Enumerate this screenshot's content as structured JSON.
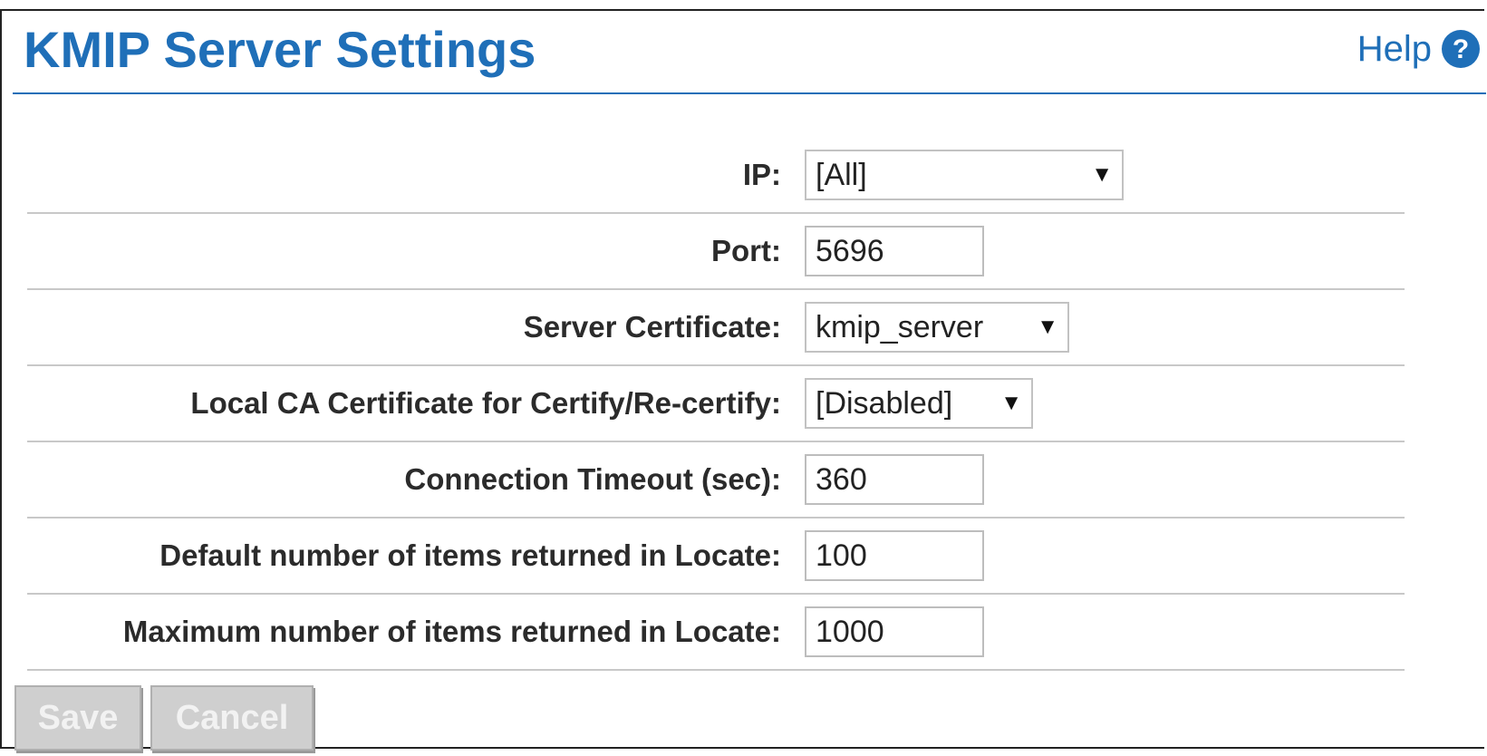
{
  "header": {
    "title": "KMIP Server Settings",
    "help_label": "Help"
  },
  "colors": {
    "accent": "#1f6fb8",
    "divider": "#c8c8c8",
    "button_disabled": "#cfcfcf"
  },
  "icons": {
    "help": "question-circle-icon",
    "dropdown": "triangle-down"
  },
  "form": {
    "ip": {
      "label": "IP:",
      "value": "[All]"
    },
    "port": {
      "label": "Port:",
      "value": "5696"
    },
    "server_certificate": {
      "label": "Server Certificate:",
      "value": "kmip_server"
    },
    "local_ca": {
      "label": "Local CA Certificate for Certify/Re-certify:",
      "value": "[Disabled]"
    },
    "connection_timeout": {
      "label": "Connection Timeout (sec):",
      "value": "360"
    },
    "default_locate": {
      "label": "Default number of items returned in Locate:",
      "value": "100"
    },
    "max_locate": {
      "label": "Maximum number of items returned in Locate:",
      "value": "1000"
    }
  },
  "buttons": {
    "save": "Save",
    "cancel": "Cancel",
    "state": "disabled"
  }
}
